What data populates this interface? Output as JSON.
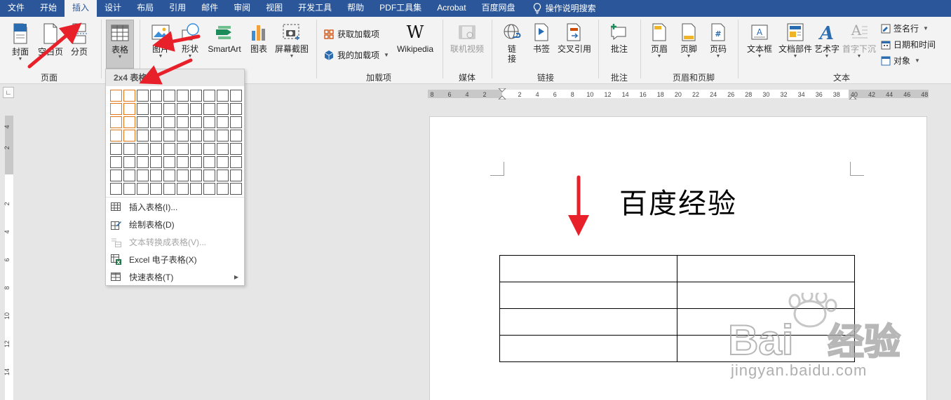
{
  "menubar": {
    "tabs": [
      "文件",
      "开始",
      "插入",
      "设计",
      "布局",
      "引用",
      "邮件",
      "审阅",
      "视图",
      "开发工具",
      "帮助",
      "PDF工具集",
      "Acrobat",
      "百度网盘"
    ],
    "active_tab": "插入",
    "tell_me": "操作说明搜索"
  },
  "ribbon": {
    "pages": {
      "cover": "封面",
      "blank": "空白页",
      "break": "分页",
      "group": "页面"
    },
    "table": {
      "label": "表格"
    },
    "illustrations": {
      "picture": "图片",
      "shapes": "形状",
      "smartart": "SmartArt",
      "chart": "图表",
      "screenshot": "屏幕截图"
    },
    "addins": {
      "get": "获取加载项",
      "mine": "我的加载项",
      "wikipedia": "Wikipedia",
      "group": "加载项"
    },
    "media": {
      "online_video": "联机视频",
      "group": "媒体"
    },
    "links": {
      "link_line1": "链",
      "link_line2": "接",
      "bookmark": "书签",
      "crossref": "交叉引用",
      "group": "链接"
    },
    "comments": {
      "comment": "批注",
      "group": "批注"
    },
    "header_footer": {
      "header": "页眉",
      "footer": "页脚",
      "page_number": "页码",
      "group": "页眉和页脚"
    },
    "text": {
      "textbox": "文本框",
      "quickparts": "文档部件",
      "wordart": "艺术字",
      "dropcap": "首字下沉",
      "signature": "签名行",
      "datetime": "日期和时间",
      "object": "对象",
      "group": "文本"
    }
  },
  "ruler": {
    "horizontal_ticks": [
      "8",
      "6",
      "4",
      "2",
      "2",
      "4",
      "6",
      "8",
      "10",
      "12",
      "14",
      "16",
      "18",
      "20",
      "22",
      "24",
      "26",
      "28",
      "30",
      "32",
      "34",
      "36",
      "38",
      "40",
      "42",
      "44",
      "46",
      "48"
    ],
    "vertical_ticks": [
      "4",
      "2",
      "2",
      "4",
      "6",
      "8",
      "10",
      "12",
      "14"
    ]
  },
  "dropdown": {
    "header": "2x4 表格",
    "grid": {
      "cols": 10,
      "rows": 8,
      "selected_cols": 2,
      "selected_rows": 4
    },
    "items": [
      {
        "label": "插入表格(I)...",
        "enabled": true,
        "submenu": false
      },
      {
        "label": "绘制表格(D)",
        "enabled": true,
        "submenu": false
      },
      {
        "label": "文本转换成表格(V)...",
        "enabled": false,
        "submenu": false
      },
      {
        "label": "Excel 电子表格(X)",
        "enabled": true,
        "submenu": false
      },
      {
        "label": "快速表格(T)",
        "enabled": true,
        "submenu": true
      }
    ]
  },
  "document": {
    "title": "百度经验",
    "table": {
      "rows": 4,
      "cols": 2
    }
  },
  "watermark": {
    "brand": "Bai",
    "brand_tail": "经验",
    "url": "jingyan.baidu.com"
  },
  "colors": {
    "ribbon_blue": "#2b579a",
    "arrow_red": "#e8202a",
    "grid_selected": "#e0761c"
  }
}
